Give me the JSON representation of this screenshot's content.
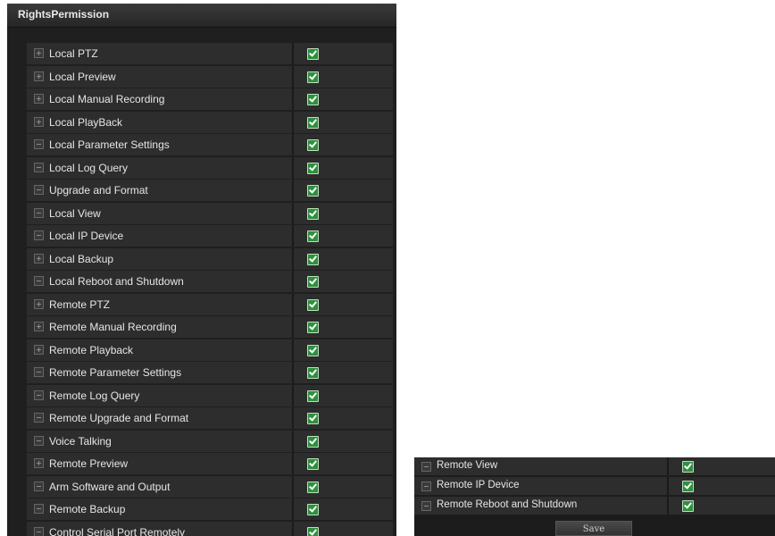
{
  "panel": {
    "title": "RightsPermission",
    "rows": [
      {
        "label": "Local PTZ",
        "toggle": "plus",
        "checked": true
      },
      {
        "label": "Local Preview",
        "toggle": "plus",
        "checked": true
      },
      {
        "label": "Local Manual Recording",
        "toggle": "plus",
        "checked": true
      },
      {
        "label": "Local PlayBack",
        "toggle": "plus",
        "checked": true
      },
      {
        "label": "Local Parameter Settings",
        "toggle": "minus",
        "checked": true
      },
      {
        "label": "Local Log Query",
        "toggle": "minus",
        "checked": true
      },
      {
        "label": "Upgrade and Format",
        "toggle": "minus",
        "checked": true
      },
      {
        "label": "Local View",
        "toggle": "minus",
        "checked": true
      },
      {
        "label": "Local IP Device",
        "toggle": "minus",
        "checked": true
      },
      {
        "label": "Local Backup",
        "toggle": "plus",
        "checked": true
      },
      {
        "label": "Local Reboot and Shutdown",
        "toggle": "minus",
        "checked": true
      },
      {
        "label": "Remote PTZ",
        "toggle": "plus",
        "checked": true
      },
      {
        "label": "Remote Manual Recording",
        "toggle": "plus",
        "checked": true
      },
      {
        "label": "Remote Playback",
        "toggle": "plus",
        "checked": true
      },
      {
        "label": "Remote Parameter Settings",
        "toggle": "minus",
        "checked": true
      },
      {
        "label": "Remote Log Query",
        "toggle": "minus",
        "checked": true
      },
      {
        "label": "Remote Upgrade and Format",
        "toggle": "minus",
        "checked": true
      },
      {
        "label": "Voice Talking",
        "toggle": "minus",
        "checked": true
      },
      {
        "label": "Remote Preview",
        "toggle": "plus",
        "checked": true
      },
      {
        "label": "Arm Software and Output",
        "toggle": "minus",
        "checked": true
      },
      {
        "label": "Remote Backup",
        "toggle": "minus",
        "checked": true
      },
      {
        "label": "Control Serial Port Remotely",
        "toggle": "minus",
        "checked": true
      }
    ]
  },
  "panel2": {
    "rows": [
      {
        "label": "Remote View",
        "toggle": "minus",
        "checked": true
      },
      {
        "label": "Remote IP Device",
        "toggle": "minus",
        "checked": true
      },
      {
        "label": "Remote Reboot and Shutdown",
        "toggle": "minus",
        "checked": true
      }
    ],
    "save_label": "Save"
  },
  "colors": {
    "panel_bg": "#1c1c1c",
    "row_bg": "#2d2d2d",
    "check_green": "#2f8f3f",
    "text": "#e6e6e6"
  },
  "icons": {
    "expand": "plus-box-icon",
    "collapse": "minus-box-icon",
    "checkbox": "checkbox-checked-icon"
  }
}
